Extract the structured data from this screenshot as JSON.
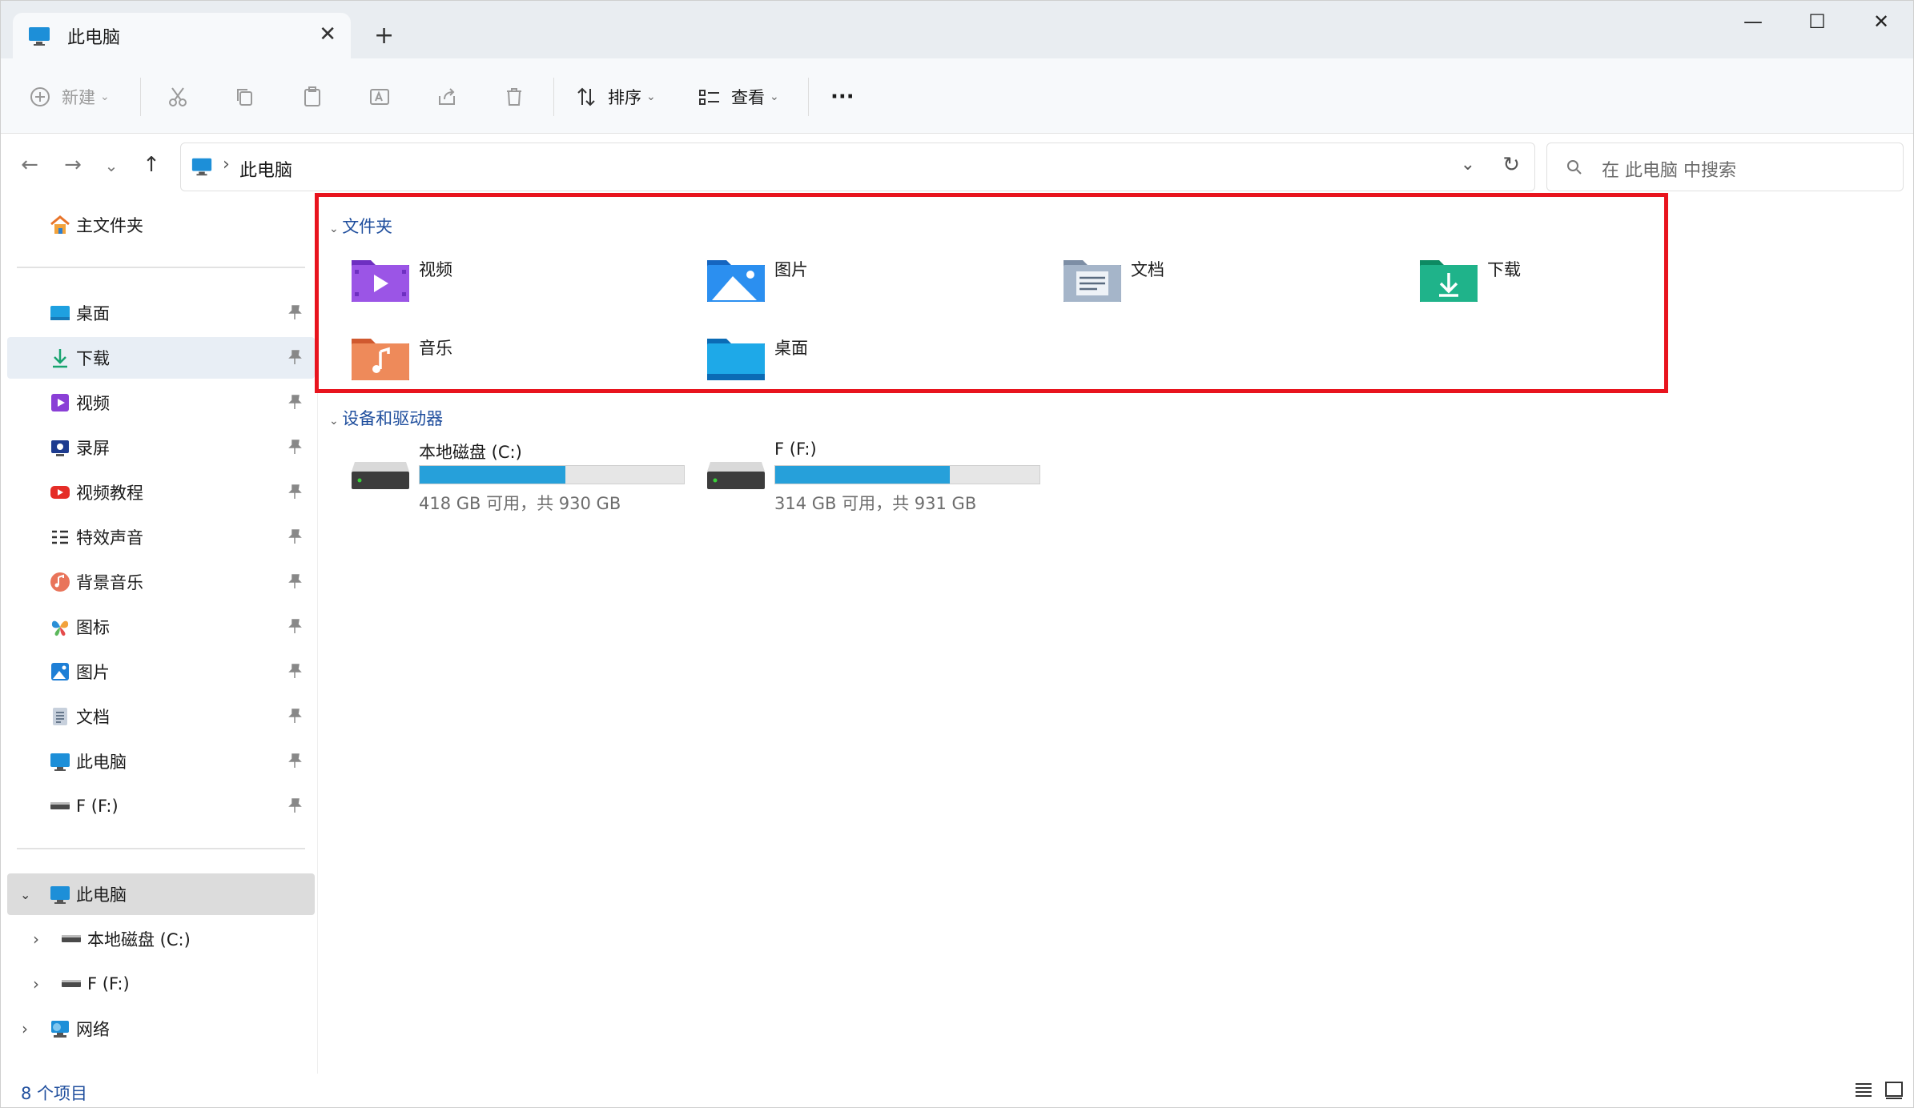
{
  "window": {
    "tab_title": "此电脑",
    "new_tab": "+",
    "minimize": "—",
    "maximize": "☐",
    "close": "✕",
    "tab_close": "✕"
  },
  "toolbar": {
    "new_label": "新建",
    "sort_label": "排序",
    "view_label": "查看",
    "more": "···"
  },
  "address": {
    "crumb": "此电脑",
    "sep": "›",
    "search_placeholder": "在 此电脑 中搜索"
  },
  "sidebar": {
    "home": "主文件夹",
    "pinned": [
      "桌面",
      "下载",
      "视频",
      "录屏",
      "视频教程",
      "特效声音",
      "背景音乐",
      "图标",
      "图片",
      "文档",
      "此电脑",
      "F (F:)"
    ],
    "tree": {
      "this_pc": "此电脑",
      "drive_c": "本地磁盘 (C:)",
      "drive_f": "F (F:)",
      "network": "网络"
    }
  },
  "content": {
    "folders_header": "文件夹",
    "folders": [
      "视频",
      "图片",
      "文档",
      "下载",
      "音乐",
      "桌面"
    ],
    "devices_header": "设备和驱动器",
    "drives": [
      {
        "name": "本地磁盘 (C:)",
        "free": "418 GB 可用，共 930 GB",
        "used_fraction": 0.55
      },
      {
        "name": "F (F:)",
        "free": "314 GB 可用，共 931 GB",
        "used_fraction": 0.66
      }
    ]
  },
  "status": {
    "count": "8 个项目"
  },
  "colors": {
    "accent": "#26a0da",
    "highlight": "#e8141e",
    "link": "#1f4e9d"
  }
}
